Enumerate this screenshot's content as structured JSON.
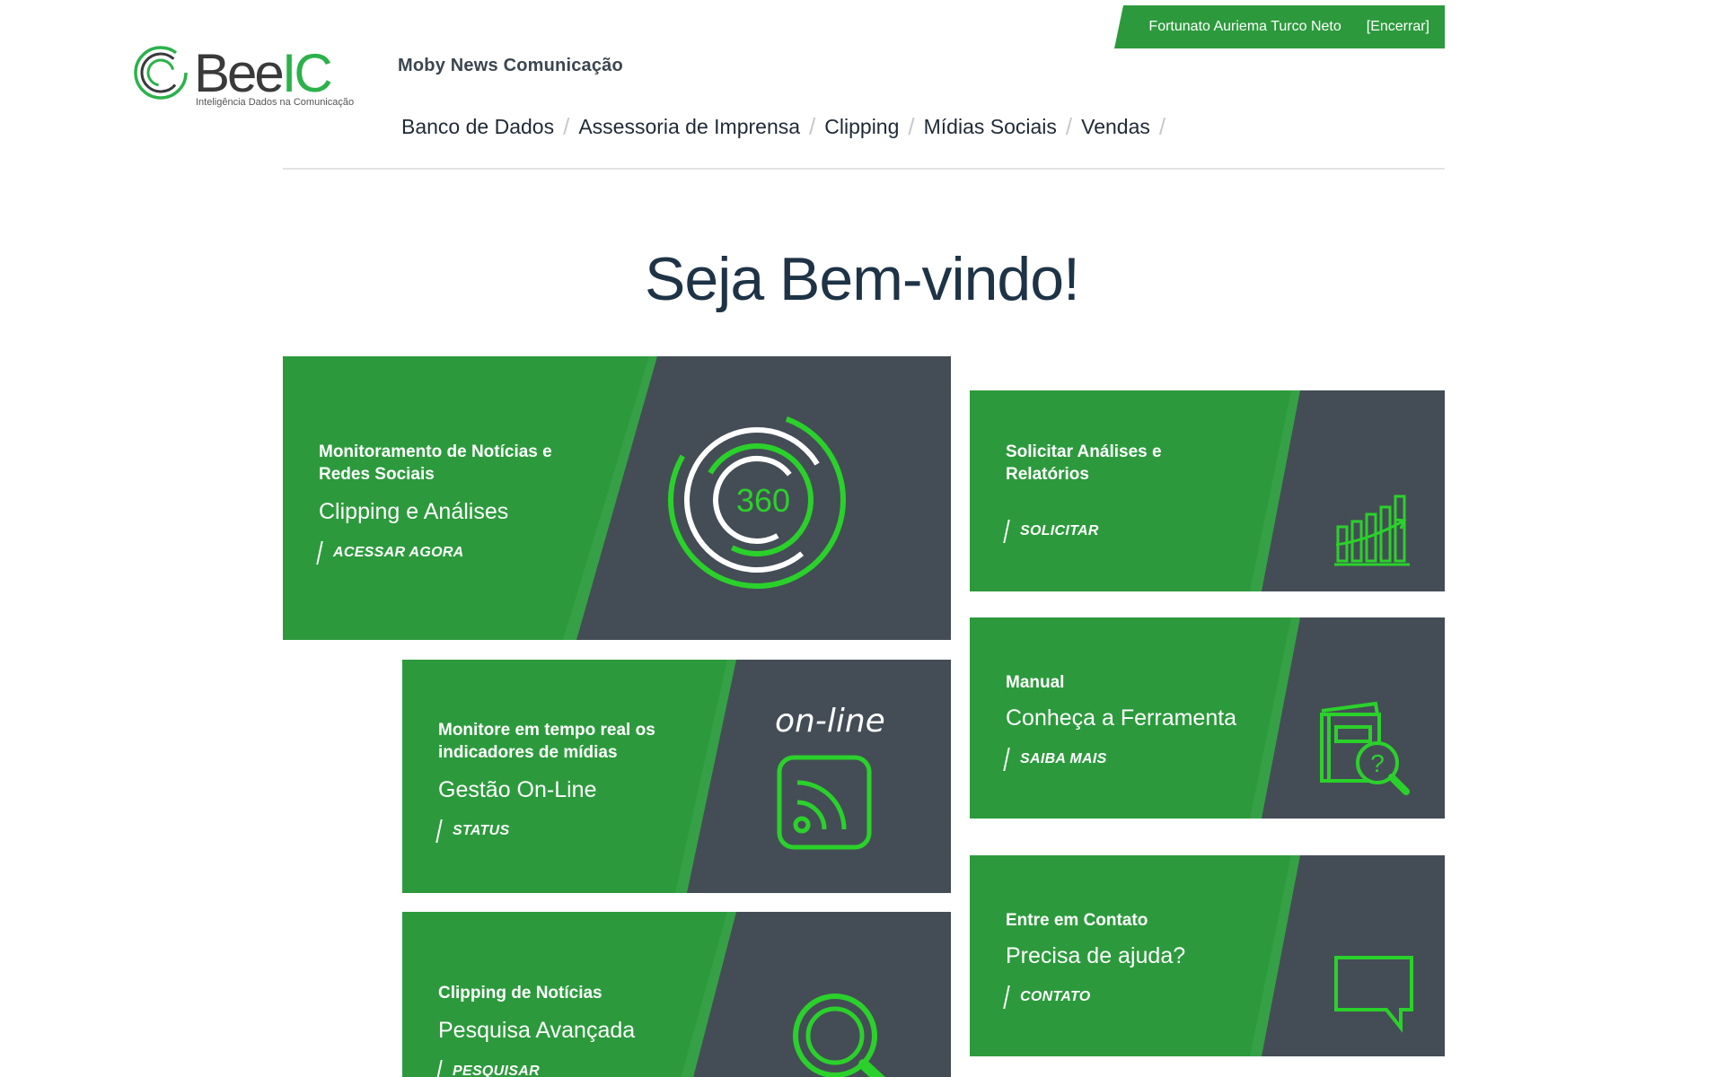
{
  "user": {
    "name": "Fortunato Auriema Turco Neto",
    "logout_label": "[Encerrar]"
  },
  "logo": {
    "brand_part1": "Bee",
    "brand_part2": "IC",
    "tagline": "Inteligência Dados na Comunicação"
  },
  "company_name": "Moby News Comunicação",
  "nav": {
    "items": [
      {
        "label": "Banco de Dados"
      },
      {
        "label": "Assessoria de Imprensa"
      },
      {
        "label": "Clipping"
      },
      {
        "label": "Mídias Sociais"
      },
      {
        "label": "Vendas"
      }
    ],
    "separator": "/"
  },
  "welcome": "Seja Bem-vindo!",
  "cards": {
    "clipping": {
      "subtitle": "Monitoramento de Notícias e Redes Sociais",
      "title": "Clipping e Análises",
      "action": "ACESSAR AGORA",
      "icon_text": "360"
    },
    "online": {
      "subtitle": "Monitore em tempo real os indicadores de mídias",
      "title": "Gestão On-Line",
      "action": "STATUS",
      "icon_text": "on-line"
    },
    "search": {
      "subtitle": "Clipping de Notícias",
      "title": "Pesquisa Avançada",
      "action": "PESQUISAR"
    },
    "reports": {
      "subtitle": "Solicitar Análises e Relatórios",
      "action": "SOLICITAR"
    },
    "manual": {
      "subtitle": "Manual",
      "title": "Conheça a Ferramenta",
      "action": "SAIBA MAIS"
    },
    "contact": {
      "subtitle": "Entre em Contato",
      "title": "Precisa de ajuda?",
      "action": "CONTATO"
    }
  },
  "colors": {
    "green": "#2c9a3c",
    "dark": "#444d55",
    "accent": "#2bd12b"
  }
}
